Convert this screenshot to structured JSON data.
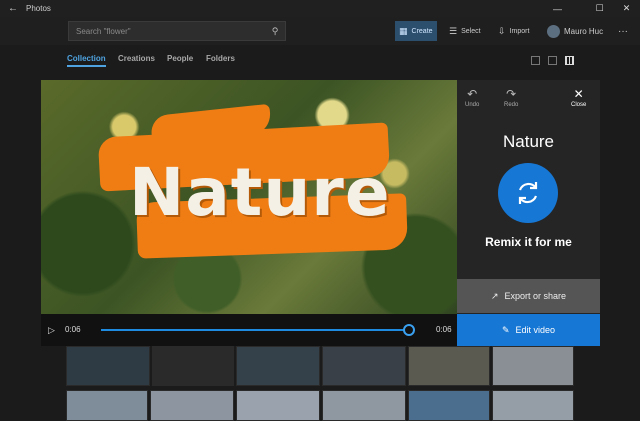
{
  "window": {
    "title": "Photos"
  },
  "cmdbar": {
    "search_placeholder": "Search \"flower\"",
    "create_label": "Create",
    "select_label": "Select",
    "import_label": "Import",
    "user_name": "Mauro Huc"
  },
  "tabs": [
    {
      "label": "Collection",
      "selected": true
    },
    {
      "label": "Creations",
      "selected": false
    },
    {
      "label": "People",
      "selected": false
    },
    {
      "label": "Folders",
      "selected": false
    }
  ],
  "preview": {
    "overlay_text": "Nature"
  },
  "panel": {
    "undo_label": "Undo",
    "redo_label": "Redo",
    "close_label": "Close",
    "title": "Nature",
    "remix_label": "Remix it for me",
    "export_label": "Export or share",
    "edit_label": "Edit video"
  },
  "player": {
    "current_time": "0:06",
    "total_time": "0:06",
    "progress": 1.0
  },
  "colors": {
    "accent": "#1777d4",
    "banner": "#f07d14"
  },
  "icons": {
    "back": "back-arrow-icon",
    "search": "search-icon",
    "play": "play-icon",
    "remix": "refresh-icon",
    "export": "share-icon",
    "edit": "edit-video-icon"
  }
}
